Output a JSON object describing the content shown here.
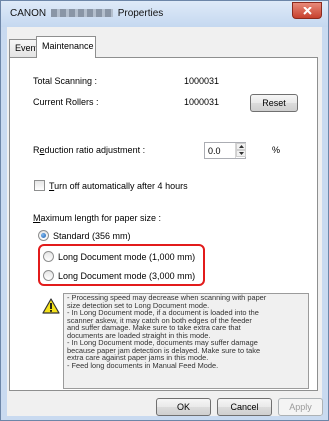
{
  "window": {
    "title_prefix": "CANON",
    "title_suffix": "Properties",
    "close_icon": "close-x-icon"
  },
  "tabs": [
    {
      "label": "Events",
      "selected": false
    },
    {
      "label": "Maintenance",
      "selected": true
    }
  ],
  "counters": {
    "total_scanning_label": "Total Scanning :",
    "total_scanning_value": "1000031",
    "current_rollers_label": "Current Rollers :",
    "current_rollers_value": "1000031",
    "reset_label": "Reset"
  },
  "reduction": {
    "label_mnemonic": "e",
    "label_before": "R",
    "label_after": "duction ratio adjustment :",
    "value": "0.0",
    "unit": "%"
  },
  "auto_off": {
    "label_mnemonic": "T",
    "label_rest": "urn off automatically after 4 hours",
    "checked": false
  },
  "paper_size": {
    "label_mnemonic": "M",
    "label_rest": "aximum length for paper size :",
    "options": [
      {
        "label": "Standard (356 mm)",
        "selected": true
      },
      {
        "label": "Long Document mode (1,000 mm)",
        "selected": false
      },
      {
        "label": "Long Document mode (3,000 mm)",
        "selected": false
      }
    ]
  },
  "note_lines": [
    "- Processing speed may decrease when scanning with paper",
    "size detection set to Long Document mode.",
    "- In Long Document mode, if a document is loaded into the",
    "scanner askew, it may catch on both edges of the feeder",
    "and suffer damage. Make sure to take extra care that",
    "documents are loaded straight in this mode.",
    "- In Long Document mode, documents may suffer damage",
    "because paper jam detection is delayed. Make sure to take",
    "extra care against paper jams in this mode.",
    "- Feed long documents in Manual Feed Mode."
  ],
  "footer": {
    "ok_label": "OK",
    "cancel_label": "Cancel",
    "apply_label": "Apply"
  },
  "colors": {
    "highlight": "#e21b1b",
    "warning_fill": "#f5e21a"
  }
}
